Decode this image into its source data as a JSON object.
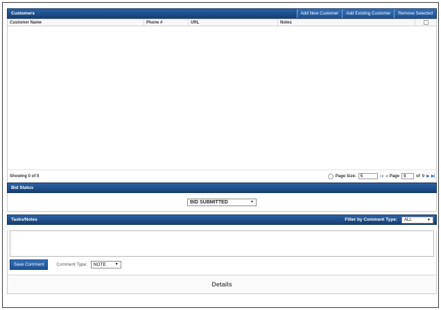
{
  "customers": {
    "title": "Customers",
    "buttons": {
      "add_new": "Add New Customer",
      "add_existing": "Add Existing Customer",
      "remove_selected": "Remove Selected"
    },
    "columns": [
      "Customer Name",
      "Phone #",
      "URL",
      "Notes"
    ],
    "rows": [],
    "pager": {
      "showing": "Showing 0 of 0",
      "page_size_label": "Page Size:",
      "page_size_value": "5",
      "page_label": "Page",
      "page_value": "0",
      "of_label": "of",
      "total_pages": "0"
    }
  },
  "bid_status": {
    "title": "Bid Status",
    "selected": "BID SUBMITTED"
  },
  "tasks": {
    "title": "Tasks/Notes",
    "filter_label": "Filter by Comment Type:",
    "filter_value": "ALL",
    "comment_value": "",
    "save_label": "Save Comment",
    "comment_type_label": "Comment Type:",
    "comment_type_value": "NOTE"
  },
  "details": {
    "label": "Details"
  },
  "colors": {
    "header_blue": "#1d4f8c",
    "button_blue": "#2a62a6"
  },
  "icons": [
    "refresh-icon",
    "first-page-icon",
    "prev-page-icon",
    "next-page-icon",
    "last-page-icon",
    "dropdown-caret-icon",
    "resize-grip-icon"
  ]
}
